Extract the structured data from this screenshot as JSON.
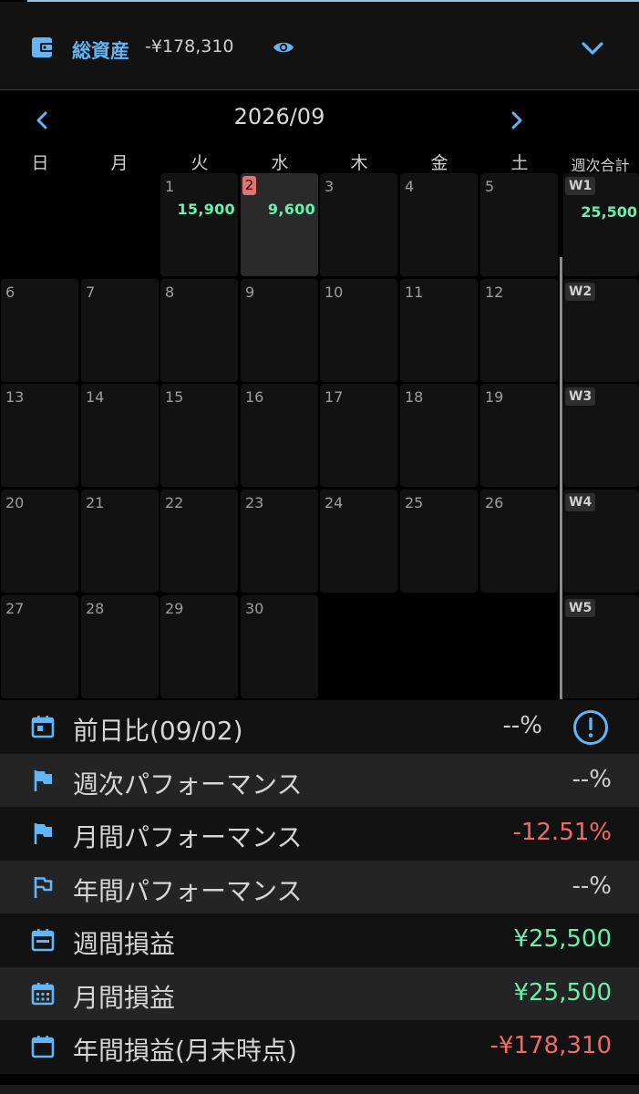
{
  "header": {
    "title": "総資産",
    "total_value": "-¥178,310",
    "icons": [
      "wallet-icon",
      "eye-icon",
      "chevron-down-icon"
    ]
  },
  "calendar": {
    "month": "2026/09",
    "weekdays": [
      "日",
      "月",
      "火",
      "水",
      "木",
      "金",
      "土"
    ],
    "weekly_header": "週次合計",
    "days": {
      "d1": {
        "num": "1",
        "amount": "15,900"
      },
      "d2": {
        "num": "2",
        "amount": "9,600"
      },
      "d3": "3",
      "d4": "4",
      "d5": "5",
      "d6": "6",
      "d7": "7",
      "d8": "8",
      "d9": "9",
      "d10": "10",
      "d11": "11",
      "d12": "12",
      "d13": "13",
      "d14": "14",
      "d15": "15",
      "d16": "16",
      "d17": "17",
      "d18": "18",
      "d19": "19",
      "d20": "20",
      "d21": "21",
      "d22": "22",
      "d23": "23",
      "d24": "24",
      "d25": "25",
      "d26": "26",
      "d27": "27",
      "d28": "28",
      "d29": "29",
      "d30": "30"
    },
    "weeks": [
      {
        "label": "W1",
        "amount": "25,500"
      },
      {
        "label": "W2"
      },
      {
        "label": "W3"
      },
      {
        "label": "W4"
      },
      {
        "label": "W5"
      }
    ]
  },
  "stats": [
    {
      "label": "前日比(09/02)",
      "value": "--%",
      "icon": "calendar-today-icon",
      "extra_icon": "info-icon"
    },
    {
      "label": "週次パフォーマンス",
      "value": "--%",
      "icon": "flag-icon"
    },
    {
      "label": "月間パフォーマンス",
      "value": "-12.51%",
      "icon": "flag-icon"
    },
    {
      "label": "年間パフォーマンス",
      "value": "--%",
      "icon": "flag-outline-icon"
    },
    {
      "label": "週間損益",
      "value": "¥25,500",
      "icon": "calendar-week-icon"
    },
    {
      "label": "月間損益",
      "value": "¥25,500",
      "icon": "calendar-month-icon"
    },
    {
      "label": "年間損益(月末時点)",
      "value": "-¥178,310",
      "icon": "calendar-blank-icon"
    }
  ],
  "colors": {
    "accent": "#64b5f6",
    "positive": "#69f0ae",
    "negative": "#ef6b6b",
    "today": "#e57373"
  }
}
